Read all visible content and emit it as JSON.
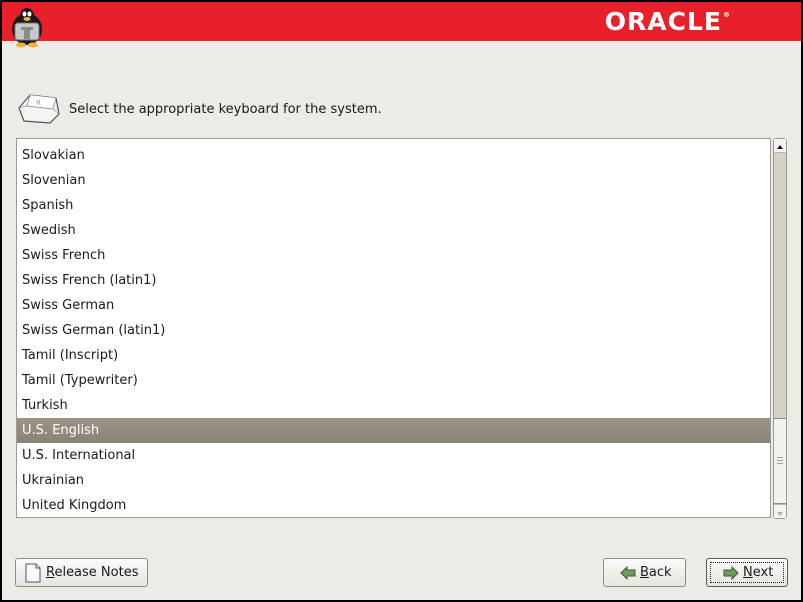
{
  "banner": {
    "brand": "ORACLE",
    "trademark": "®",
    "logo_icon": "tux-penguin-icon",
    "color": "#e8202a"
  },
  "prompt": {
    "icon": "keyboard-key-icon",
    "text": "Select the appropriate keyboard for the system."
  },
  "keyboard_list": {
    "items": [
      "Slovakian",
      "Slovenian",
      "Spanish",
      "Swedish",
      "Swiss French",
      "Swiss French (latin1)",
      "Swiss German",
      "Swiss German (latin1)",
      "Tamil (Inscript)",
      "Tamil (Typewriter)",
      "Turkish",
      "U.S. English",
      "U.S. International",
      "Ukrainian",
      "United Kingdom"
    ],
    "selected": "U.S. English",
    "selection_color": "#938b7e",
    "scroll_position_percent": 90
  },
  "buttons": {
    "release_notes": {
      "mnemonic": "R",
      "rest": "elease Notes",
      "icon": "document-icon"
    },
    "back": {
      "mnemonic": "B",
      "rest": "ack",
      "icon": "arrow-left-icon"
    },
    "next": {
      "mnemonic": "N",
      "rest": "ext",
      "icon": "arrow-right-icon"
    }
  }
}
